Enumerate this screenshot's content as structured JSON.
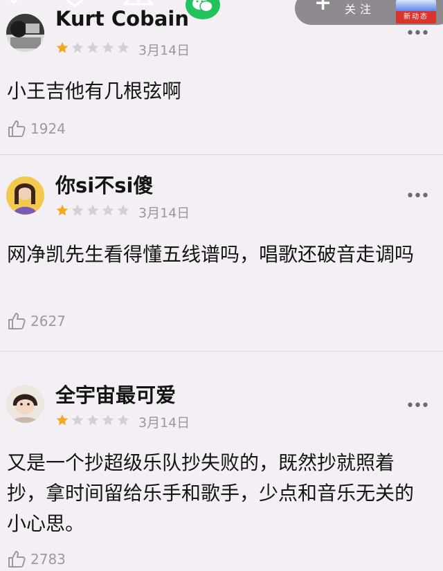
{
  "overlay": {
    "follow_plus": "+",
    "follow_label": "关注",
    "logo_bottom": "新动态"
  },
  "comments": [
    {
      "username": "Kurt Cobain",
      "rating": 1,
      "rating_max": 5,
      "date": "3月14日",
      "text": "小王吉他有几根弦啊",
      "likes": "1924"
    },
    {
      "username": "你si不si傻",
      "rating": 1,
      "rating_max": 5,
      "date": "3月14日",
      "text": "网净凯先生看得懂五线谱吗，唱歌还破音走调吗",
      "likes": "2627"
    },
    {
      "username": "全宇宙最可爱",
      "rating": 1,
      "rating_max": 5,
      "date": "3月14日",
      "text": "又是一个抄超级乐队抄失败的，既然抄就照着抄，拿时间留给乐手和歌手，少点和音乐无关的小心思。",
      "likes": "2783"
    }
  ],
  "colors": {
    "background": "#f3eff4",
    "star_filled": "#f5a623",
    "star_empty": "#d3d0d5",
    "meta_text": "#9a979c"
  },
  "icons": {
    "like": "thumbs-up-icon",
    "more": "more-dots-icon",
    "star": "star-icon"
  }
}
